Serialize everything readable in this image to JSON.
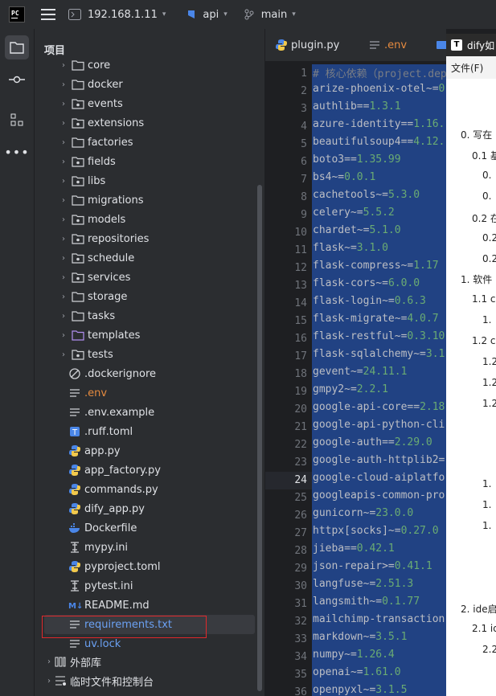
{
  "topbar": {
    "logo_text": "PC",
    "host": "192.168.1.11",
    "project": "api",
    "branch": "main"
  },
  "project_panel": {
    "title": "项目",
    "tree": [
      {
        "label": "core",
        "kind": "folder"
      },
      {
        "label": "docker",
        "kind": "folder"
      },
      {
        "label": "events",
        "kind": "package"
      },
      {
        "label": "extensions",
        "kind": "package"
      },
      {
        "label": "factories",
        "kind": "folder"
      },
      {
        "label": "fields",
        "kind": "package"
      },
      {
        "label": "libs",
        "kind": "package"
      },
      {
        "label": "migrations",
        "kind": "folder"
      },
      {
        "label": "models",
        "kind": "package"
      },
      {
        "label": "repositories",
        "kind": "package"
      },
      {
        "label": "schedule",
        "kind": "package"
      },
      {
        "label": "services",
        "kind": "package"
      },
      {
        "label": "storage",
        "kind": "folder"
      },
      {
        "label": "tasks",
        "kind": "folder"
      },
      {
        "label": "templates",
        "kind": "template-folder"
      },
      {
        "label": "tests",
        "kind": "package"
      },
      {
        "label": ".dockerignore",
        "kind": "ignore"
      },
      {
        "label": ".env",
        "kind": "env"
      },
      {
        "label": ".env.example",
        "kind": "text"
      },
      {
        "label": ".ruff.toml",
        "kind": "toml"
      },
      {
        "label": "app.py",
        "kind": "python"
      },
      {
        "label": "app_factory.py",
        "kind": "python"
      },
      {
        "label": "commands.py",
        "kind": "python"
      },
      {
        "label": "dify_app.py",
        "kind": "python"
      },
      {
        "label": "Dockerfile",
        "kind": "docker"
      },
      {
        "label": "mypy.ini",
        "kind": "ini"
      },
      {
        "label": "pyproject.toml",
        "kind": "python"
      },
      {
        "label": "pytest.ini",
        "kind": "ini"
      },
      {
        "label": "README.md",
        "kind": "markdown"
      },
      {
        "label": "requirements.txt",
        "kind": "text"
      },
      {
        "label": "uv.lock",
        "kind": "text"
      }
    ],
    "external_libs": "外部库",
    "scratches": "临时文件和控制台"
  },
  "tabs": [
    {
      "label": "plugin.py",
      "icon": "python-icon"
    },
    {
      "label": ".env",
      "icon": "text-icon"
    }
  ],
  "editor": {
    "lines": [
      {
        "n": "1",
        "pkg": "# 核心依赖（project.dep",
        "op": "",
        "ver": ""
      },
      {
        "n": "2",
        "pkg": "arize-phoenix-otel",
        "op": "~=",
        "ver": "0"
      },
      {
        "n": "3",
        "pkg": "authlib",
        "op": "==",
        "ver": "1.3.1"
      },
      {
        "n": "4",
        "pkg": "azure-identity",
        "op": "==",
        "ver": "1.16."
      },
      {
        "n": "5",
        "pkg": "beautifulsoup4",
        "op": "==",
        "ver": "4.12."
      },
      {
        "n": "6",
        "pkg": "boto3",
        "op": "==",
        "ver": "1.35.99"
      },
      {
        "n": "7",
        "pkg": "bs4",
        "op": "~=",
        "ver": "0.0.1"
      },
      {
        "n": "8",
        "pkg": "cachetools",
        "op": "~=",
        "ver": "5.3.0"
      },
      {
        "n": "9",
        "pkg": "celery",
        "op": "~=",
        "ver": "5.5.2"
      },
      {
        "n": "10",
        "pkg": "chardet",
        "op": "~=",
        "ver": "5.1.0"
      },
      {
        "n": "11",
        "pkg": "flask",
        "op": "~=",
        "ver": "3.1.0"
      },
      {
        "n": "12",
        "pkg": "flask-compress",
        "op": "~=",
        "ver": "1.17"
      },
      {
        "n": "13",
        "pkg": "flask-cors",
        "op": "~=",
        "ver": "6.0.0"
      },
      {
        "n": "14",
        "pkg": "flask-login",
        "op": "~=",
        "ver": "0.6.3"
      },
      {
        "n": "15",
        "pkg": "flask-migrate",
        "op": "~=",
        "ver": "4.0.7"
      },
      {
        "n": "16",
        "pkg": "flask-restful",
        "op": "~=",
        "ver": "0.3.10"
      },
      {
        "n": "17",
        "pkg": "flask-sqlalchemy",
        "op": "~=",
        "ver": "3.1"
      },
      {
        "n": "18",
        "pkg": "gevent",
        "op": "~=",
        "ver": "24.11.1"
      },
      {
        "n": "19",
        "pkg": "gmpy2",
        "op": "~=",
        "ver": "2.2.1"
      },
      {
        "n": "20",
        "pkg": "google-api-core",
        "op": "==",
        "ver": "2.18"
      },
      {
        "n": "21",
        "pkg": "google-api-python-cli",
        "op": "",
        "ver": ""
      },
      {
        "n": "22",
        "pkg": "google-auth",
        "op": "==",
        "ver": "2.29.0"
      },
      {
        "n": "23",
        "pkg": "google-auth-httplib2",
        "op": "=",
        "ver": ""
      },
      {
        "n": "24",
        "pkg": "google-cloud-aiplatfo",
        "op": "",
        "ver": ""
      },
      {
        "n": "25",
        "pkg": "googleapis-common-pro",
        "op": "",
        "ver": ""
      },
      {
        "n": "26",
        "pkg": "gunicorn",
        "op": "~=",
        "ver": "23.0.0"
      },
      {
        "n": "27",
        "pkg": "httpx[socks]",
        "op": "~=",
        "ver": "0.27.0"
      },
      {
        "n": "28",
        "pkg": "jieba",
        "op": "==",
        "ver": "0.42.1"
      },
      {
        "n": "29",
        "pkg": "json-repair",
        "op": ">=",
        "ver": "0.41.1"
      },
      {
        "n": "30",
        "pkg": "langfuse",
        "op": "~=",
        "ver": "2.51.3"
      },
      {
        "n": "31",
        "pkg": "langsmith",
        "op": "~=",
        "ver": "0.1.77"
      },
      {
        "n": "32",
        "pkg": "mailchimp-transaction",
        "op": "",
        "ver": ""
      },
      {
        "n": "33",
        "pkg": "markdown",
        "op": "~=",
        "ver": "3.5.1"
      },
      {
        "n": "34",
        "pkg": "numpy",
        "op": "~=",
        "ver": "1.26.4"
      },
      {
        "n": "35",
        "pkg": "openai",
        "op": "~=",
        "ver": "1.61.0"
      },
      {
        "n": "36",
        "pkg": "openpyxl",
        "op": "~=",
        "ver": "3.1.5"
      }
    ],
    "current_line": "24"
  },
  "right_window": {
    "title": "dify如",
    "menu": "文件(F)",
    "toc": [
      "0. 写在",
      "0.1 基",
      "0.",
      "0.",
      "0.2 在",
      "0.2",
      "0.2",
      "1. 软件",
      "1.1 c",
      "1.",
      "1.2 c",
      "1.2",
      "1.2",
      "1.2",
      "1.",
      "1.",
      "1.",
      "2. ide启",
      "2.1 id",
      "2.2"
    ]
  }
}
